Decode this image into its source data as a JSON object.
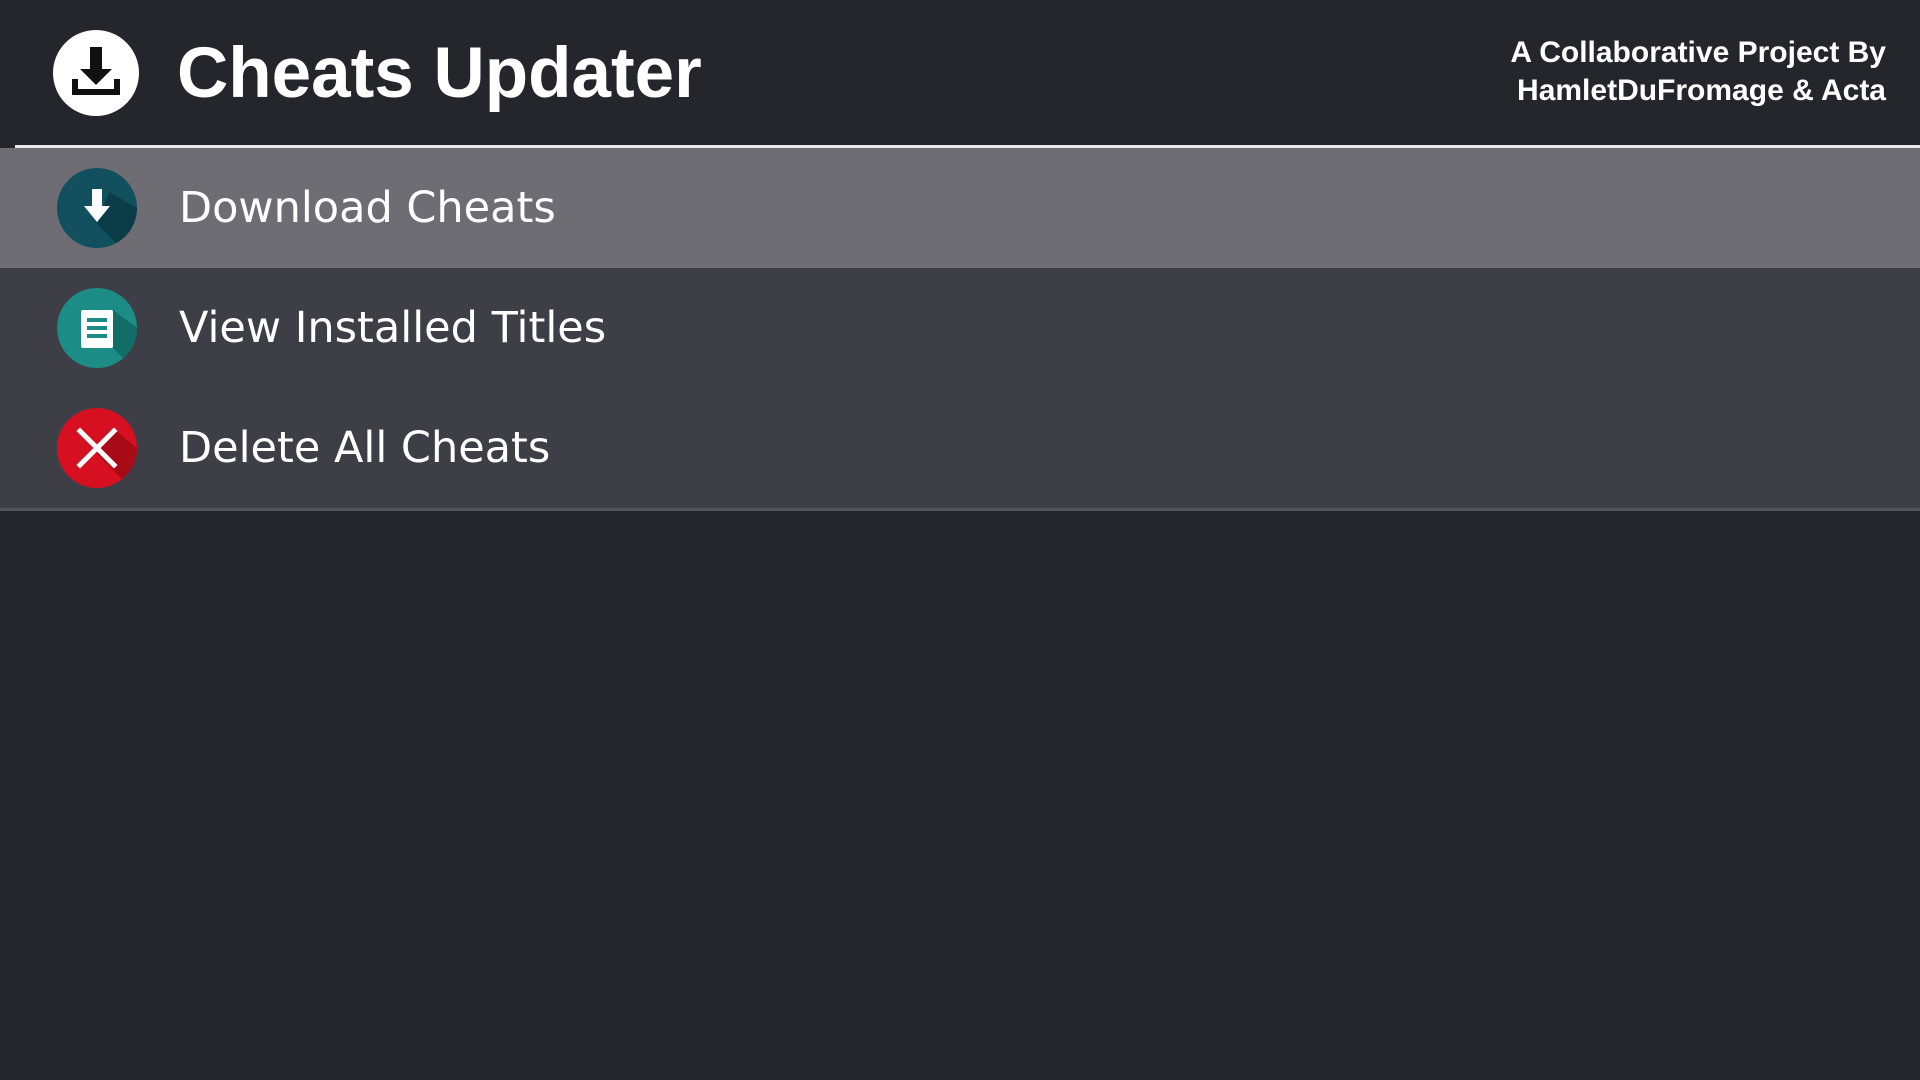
{
  "header": {
    "title": "Cheats Updater",
    "logo_icon": "download-tray-icon",
    "credits_line1": "A Collaborative Project By",
    "credits_line2": "HamletDuFromage & Acta"
  },
  "menu": {
    "selected_index": 0,
    "items": [
      {
        "label": "Download Cheats",
        "icon": "download-arrow-icon",
        "color": "#12505f"
      },
      {
        "label": "View Installed Titles",
        "icon": "document-icon",
        "color": "#1c8c86"
      },
      {
        "label": "Delete All Cheats",
        "icon": "close-icon",
        "color": "#d61020"
      }
    ]
  },
  "colors": {
    "background": "#25252c",
    "menu_background": "#3e3e46",
    "selected_background": "#6e6d73",
    "divider": "#e8e8ea"
  }
}
